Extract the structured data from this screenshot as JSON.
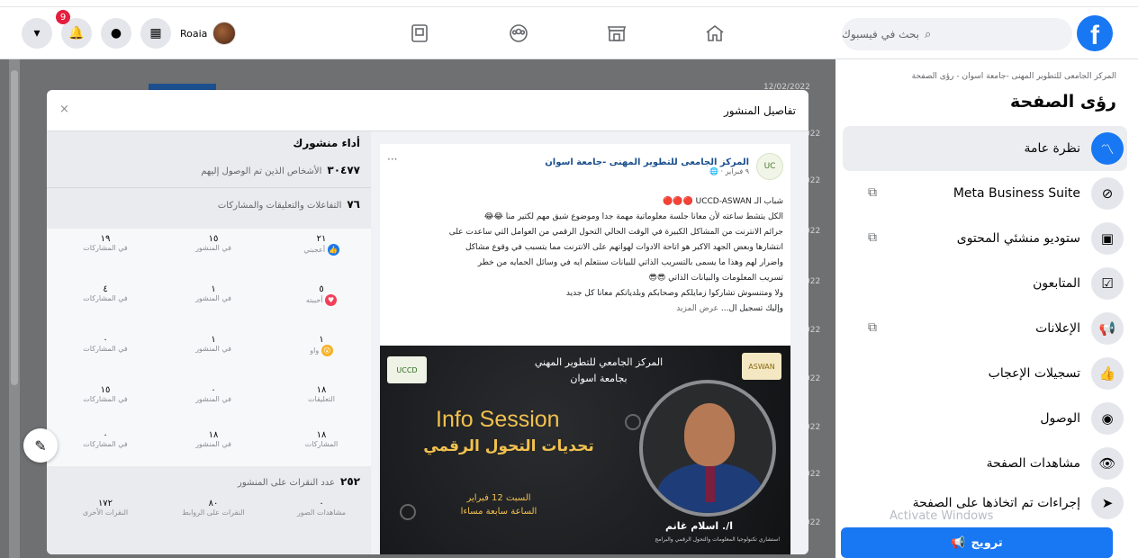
{
  "topbar": {
    "notification_count": "9",
    "profile_name": "Roaia",
    "search_placeholder": "بحث في فيسبوك",
    "logo_letter": "f"
  },
  "sidebar": {
    "breadcrumb": "المركز الجامعى للتطوير المهنى -جامعة اسوان - رؤى الصفحة",
    "title": "رؤى الصفحة",
    "items": [
      {
        "label": "نظرة عامة",
        "icon": "overview-icon",
        "active": true
      },
      {
        "label": "Meta Business Suite",
        "icon": "business-suite-icon",
        "external": true
      },
      {
        "label": "ستوديو منشئي المحتوى",
        "icon": "creator-studio-icon",
        "external": true
      },
      {
        "label": "المتابعون",
        "icon": "followers-icon"
      },
      {
        "label": "الإعلانات",
        "icon": "megaphone-icon",
        "external": true
      },
      {
        "label": "تسجيلات الإعجاب",
        "icon": "thumbs-up-icon"
      },
      {
        "label": "الوصول",
        "icon": "reach-icon"
      },
      {
        "label": "مشاهدات الصفحة",
        "icon": "eye-icon"
      },
      {
        "label": "إجراءات تم اتخاذها على الصفحة",
        "icon": "cursor-icon"
      }
    ],
    "promote_label": "ترويج",
    "watermark": "Activate Windows"
  },
  "background": {
    "date_header": "12/02/2022",
    "row_fragments": [
      "022",
      "022",
      "022",
      "022",
      "022",
      "022",
      "022",
      "022",
      "022",
      "022"
    ]
  },
  "modal": {
    "title": "تفاصيل المنشور",
    "close": "×",
    "stats": {
      "heading": "أداء منشورك",
      "reach_value": "٣٠٤٧٧",
      "reach_label": "الأشخاص الذين تم الوصول إليهم",
      "engagement_value": "٧٦",
      "engagement_label": "التفاعلات والتعليقات والمشاركات",
      "reaction_rows": [
        {
          "icon": "like-icon",
          "icon_color": "#1877f2",
          "label": "أعجبني",
          "total": "٢١",
          "on_post": "١٥",
          "on_shares": "١٩",
          "on_post_label": "في المنشور",
          "on_shares_label": "في المشاركات"
        },
        {
          "icon": "love-icon",
          "icon_color": "#f33e58",
          "label": "أحببته",
          "total": "٥",
          "on_post": "١",
          "on_shares": "٤",
          "on_post_label": "في المنشور",
          "on_shares_label": "في المشاركات"
        },
        {
          "icon": "wow-icon",
          "icon_color": "#f7b125",
          "label": "واو",
          "total": "١",
          "on_post": "١",
          "on_shares": "٠",
          "on_post_label": "في المنشور",
          "on_shares_label": "في المشاركات"
        },
        {
          "icon": "comment-icon",
          "icon_color": "#8a8d91",
          "label": "التعليقات",
          "total": "١٨",
          "on_post": "٠",
          "on_shares": "١٥",
          "on_post_label": "في المنشور",
          "on_shares_label": "في المشاركات"
        },
        {
          "icon": "share-icon",
          "icon_color": "#8a8d91",
          "label": "المشاركات",
          "total": "١٨",
          "on_post": "١٨",
          "on_shares": "٠",
          "on_post_label": "في المنشور",
          "on_shares_label": "في المشاركات"
        }
      ],
      "clicks_value": "٢٥٢",
      "clicks_label": "عدد النقرات على المنشور",
      "clicks_breakdown": [
        {
          "value": "٠",
          "label": "مشاهدات الصور"
        },
        {
          "value": "٨٠",
          "label": "النقرات على الروابط"
        },
        {
          "value": "١٧٢",
          "label": "النقرات الأخرى"
        }
      ]
    },
    "post": {
      "page_name": "المركز الجامعى للتطوير المهنى -جامعة اسوان",
      "meta": "٩ فبراير · 🌐",
      "more": "···",
      "text_lines": [
        "شباب الـ UCCD-ASWAN 🔴🔴🔴",
        "الكل يتشط ساعته لأن معانا جلسة معلوماتية مهمة جدا وموضوع شيق مهم لكتير منا 😂😂",
        "جرائم الانترنت من المشاكل الكبيرة في الوقت الحالي التحول الرقمي من العوامل التي ساعدت على",
        "انتشارها وبعض الجهد الاكبر هو اتاحة الادوات لهواتهم على الانترنت مما يتسبب في وقوع مشاكل",
        "واضرار لهم وهذا ما يسمى بالتسريب الذاتي للبيانات سنتعلم ايه في وسائل الحمايه من خطر",
        "تسريب المعلومات والبيانات الذاتي 😎😎",
        "ولا ومتنسوش تشاركوا زمايلكم وصحابكم وبلدياتكم معانا كل جديد"
      ],
      "see_more_prefix": "وإليك تسجيل ال... ",
      "see_more": "عرض المزيد",
      "banner": {
        "org_line1": "المركز الجامعي للتطوير المهني",
        "org_line2": "بجامعة اسوان",
        "headline": "Info Session",
        "subtitle": "تحديات التحول الرقمي",
        "date_line1": "السبت 12 فبراير",
        "date_line2": "الساعة سابعة مساءا",
        "presenter": "ا/. اسلام غانم",
        "presenter_role": "استشاري تكنولوجيا المعلومات والتحول الرقمي والبرامج",
        "logo_left": "UCCD",
        "logo_right": "ASWAN"
      }
    }
  }
}
